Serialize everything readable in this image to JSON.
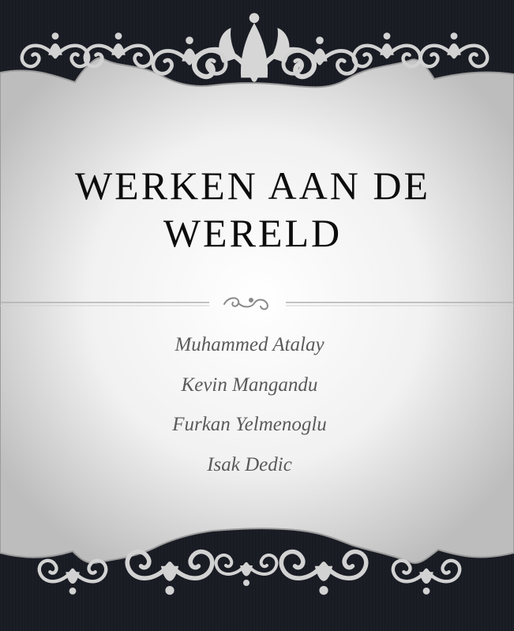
{
  "slide": {
    "title_lines": [
      "WERKEN AAN DE",
      "WERELD"
    ],
    "authors": [
      "Muhammed Atalay",
      "Kevin Mangandu",
      "Furkan Yelmenoglu",
      "Isak Dedic"
    ]
  },
  "colors": {
    "band": "#14161d",
    "panel_center": "#ffffff",
    "panel_edge": "#b9b9b9",
    "ornament": "#cfcfcf",
    "title": "#0d0d0d",
    "author": "#5a5a5a"
  },
  "icons": {
    "top_ornament": "damask-flourish-icon",
    "bottom_ornament": "damask-flourish-icon",
    "divider_ornament": "scroll-flourish-icon"
  }
}
